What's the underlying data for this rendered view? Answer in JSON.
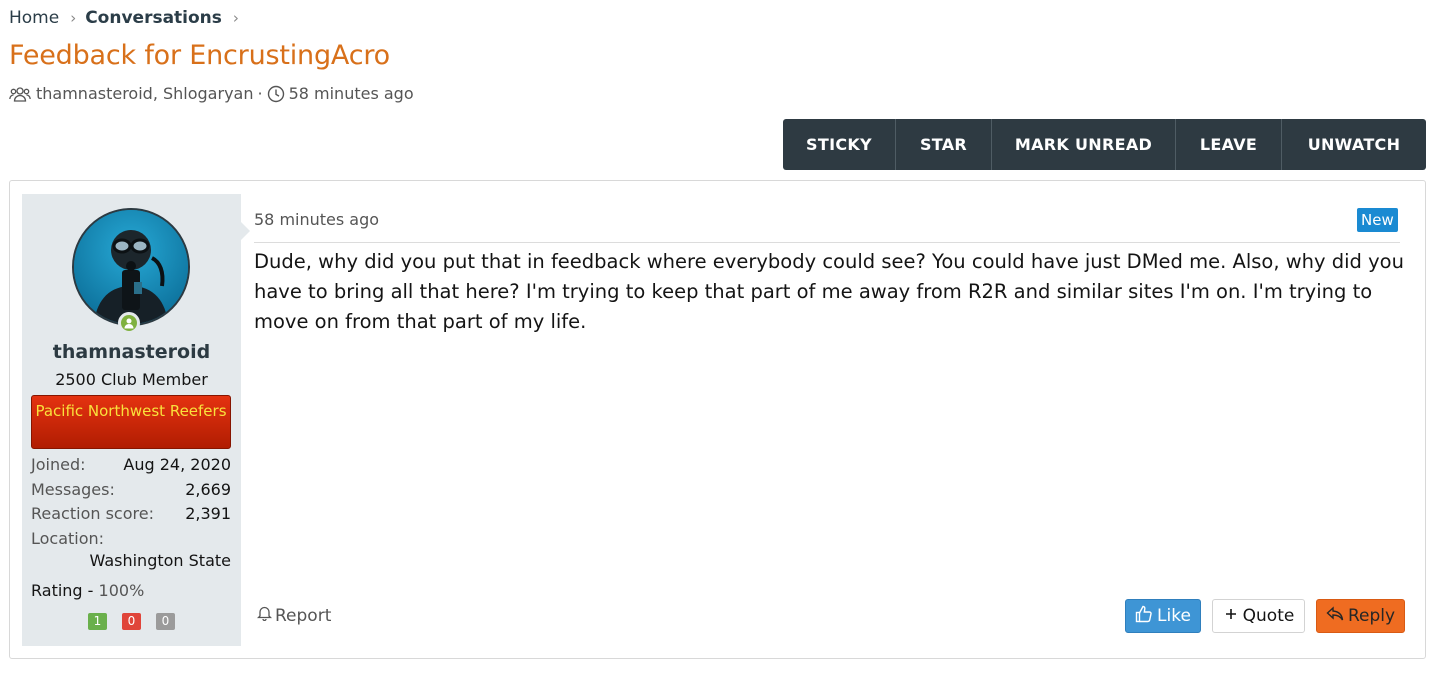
{
  "breadcrumb": {
    "home": "Home",
    "conversations": "Conversations",
    "sep": "›"
  },
  "title": "Feedback for EncrustingAcro",
  "meta": {
    "participants": "thamnasteroid, Shlogaryan",
    "separator": "·",
    "time": "58 minutes ago"
  },
  "actions": [
    "STICKY",
    "STAR",
    "MARK UNREAD",
    "LEAVE",
    "UNWATCH"
  ],
  "user": {
    "name": "thamnasteroid",
    "title": "2500 Club Member",
    "banner": "Pacific Northwest Reefers",
    "stats": {
      "joined_label": "Joined:",
      "joined": "Aug 24, 2020",
      "messages_label": "Messages:",
      "messages": "2,669",
      "reaction_label": "Reaction score:",
      "reaction": "2,391",
      "location_label": "Location:",
      "location": "Washington State"
    },
    "rating_label": "Rating - ",
    "rating_value": "100%",
    "counts": {
      "positive": "1",
      "negative": "0",
      "neutral": "0"
    }
  },
  "message": {
    "time": "58 minutes ago",
    "badge": "New",
    "text": "Dude, why did you put that in feedback where everybody could see? You could have just DMed me. Also, why did you have to bring all that here? I'm trying to keep that part of me away from R2R and similar sites I'm on. I'm trying to move on from that part of my life.",
    "report": "Report",
    "like": "Like",
    "quote": "Quote",
    "reply": "Reply"
  },
  "colors": {
    "title": "#d8701a",
    "action_bar": "#2e3a42",
    "banner": "#cf2809",
    "new_badge": "#1a8ad2",
    "like": "#3e95d5",
    "reply": "#ef6c21",
    "positive": "#6ab04c",
    "negative": "#e0453a",
    "neutral": "#9b9b9b"
  }
}
